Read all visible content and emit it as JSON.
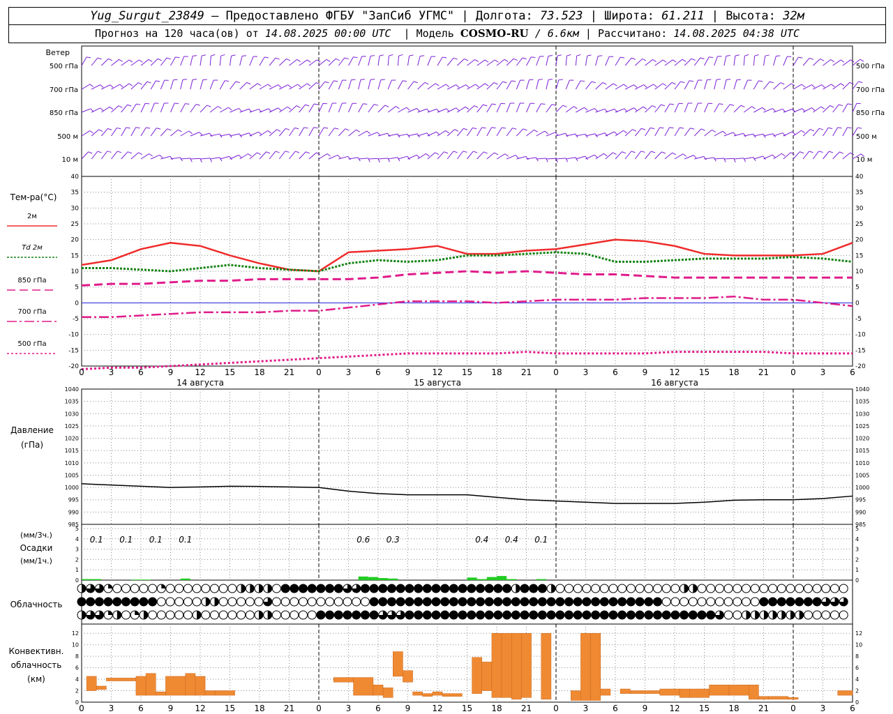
{
  "header": {
    "station": "Yug_Surgut_23849",
    "provider": "— Предоставлено ФГБУ \"ЗапСиб УГМС\"",
    "lon_label": "Долгота:",
    "lon": "73.523",
    "lat_label": "Широта:",
    "lat": "61.211",
    "alt_label": "Высота:",
    "alt": "32м",
    "forecast_label": "Прогноз на 120 часа(ов) от",
    "forecast_from": "14.08.2025 00:00 UTC",
    "model_label": "Модель",
    "model": "COSMO-RU",
    "resolution": "/ 6.6км",
    "computed_label": "Рассчитано:",
    "computed": "14.08.2025 04:38 UTC"
  },
  "labels": {
    "wind": "Ветер",
    "wind_levels": [
      "500 гПа",
      "700 гПа",
      "850 гПа",
      "500 м",
      "10  м"
    ],
    "temp_title": "Тем-ра(°С)",
    "temp_legend": [
      "2м",
      "Td  2м",
      "850 гПа",
      "700 гПа",
      "500 гПа"
    ],
    "pressure_title": "Давление",
    "pressure_unit": "(гПа)",
    "precip_unit_top": "(мм/3ч.)",
    "precip_title": "Осадки",
    "precip_unit_bottom": "(мм/1ч.)",
    "cloud_title": "Облачность",
    "conv_title": "Конвективн.",
    "conv_title2": "облачность",
    "conv_unit": "(км)"
  },
  "colors": {
    "wind": "#7b1fd6",
    "t2m": "#ef2b2b",
    "td2m": "#138213",
    "t850": "#e01b8a",
    "t700": "#e01b8a",
    "t500": "#e01b8a",
    "zero_line": "#2020e0",
    "pressure": "#000000",
    "precip": "#22cc22",
    "conv": "#ef8a33"
  },
  "chart_data": [
    {
      "type": "line",
      "title": "Тем-ра(°С)",
      "x_hours": [
        0,
        3,
        6,
        9,
        12,
        15,
        18,
        21,
        24,
        27,
        30,
        33,
        36,
        39,
        42,
        45,
        48,
        51,
        54,
        57,
        60,
        63,
        66,
        69,
        72,
        75,
        78
      ],
      "x_tick_labels": [
        "0",
        "3",
        "6",
        "9",
        "12",
        "15",
        "18",
        "21",
        "0",
        "3",
        "6",
        "9",
        "12",
        "15",
        "18",
        "21",
        "0",
        "3",
        "6",
        "9",
        "12",
        "15",
        "18",
        "21",
        "0",
        "3",
        "6"
      ],
      "day_labels": [
        "14 августа",
        "15 августа",
        "16 августа"
      ],
      "ylim": [
        -20,
        40
      ],
      "y_ticks": [
        40,
        35,
        30,
        25,
        20,
        15,
        10,
        5,
        0,
        -5,
        -10,
        -15,
        -20
      ],
      "series": [
        {
          "name": "2м",
          "values": [
            12,
            13.5,
            17,
            19,
            18,
            15,
            12.5,
            10.5,
            10,
            16,
            16.5,
            17,
            18,
            15.5,
            15.5,
            16.5,
            17,
            18.5,
            20,
            19.5,
            18,
            15.5,
            15,
            15,
            15,
            15.5,
            19
          ]
        },
        {
          "name": "Td  2м",
          "values": [
            11,
            11,
            10.5,
            10,
            11,
            12,
            11,
            10.5,
            10,
            12.5,
            13.5,
            13,
            13.5,
            15,
            15,
            15.5,
            16,
            15.5,
            13,
            13,
            13.5,
            14,
            14,
            14,
            14.5,
            14,
            13
          ]
        },
        {
          "name": "850 гПа",
          "values": [
            5.5,
            6,
            6,
            6.5,
            7,
            7,
            7.5,
            7.5,
            7.5,
            7.5,
            8,
            9,
            9.5,
            10,
            9.5,
            10,
            9.5,
            9,
            9,
            8.5,
            8,
            8,
            8,
            8,
            8,
            8,
            8
          ]
        },
        {
          "name": "700 гПа",
          "values": [
            -4.5,
            -4.5,
            -4,
            -3.5,
            -3,
            -3,
            -3,
            -2.5,
            -2.5,
            -1.5,
            -0.5,
            0.5,
            0.5,
            0.5,
            0,
            0.5,
            1,
            1,
            1,
            1.5,
            1.5,
            1.5,
            2,
            1,
            1,
            0,
            -1
          ]
        },
        {
          "name": "500 гПа",
          "values": [
            -21,
            -20.5,
            -20.5,
            -20,
            -19.5,
            -19,
            -18.5,
            -18,
            -17.5,
            -17,
            -16.5,
            -16,
            -16,
            -16,
            -16,
            -15.5,
            -16,
            -16,
            -16,
            -16,
            -15.5,
            -15.5,
            -15.5,
            -15.5,
            -16,
            -16,
            -16
          ]
        }
      ]
    },
    {
      "type": "line",
      "title": "Давление",
      "ylabel": "(гПа)",
      "ylim": [
        985,
        1040
      ],
      "y_ticks": [
        1040,
        1035,
        1030,
        1025,
        1020,
        1015,
        1010,
        1005,
        1000,
        995,
        990,
        985
      ],
      "series": [
        {
          "name": "pressure",
          "values": [
            1001.5,
            1001,
            1000.5,
            1000,
            1000.2,
            1000.5,
            1000.4,
            1000.2,
            1000,
            998.5,
            997.5,
            997,
            997,
            997,
            996,
            995,
            994.5,
            994,
            993.5,
            993.5,
            993.5,
            994,
            994.8,
            995,
            995,
            995.5,
            996.5
          ]
        }
      ]
    },
    {
      "type": "bar",
      "title": "Осадки",
      "ylim": [
        0,
        5
      ],
      "y_ticks": [
        5,
        4,
        3,
        2,
        1,
        0
      ],
      "accumulations_3h": [
        {
          "hour": 1.5,
          "label": "0.1"
        },
        {
          "hour": 4.5,
          "label": "0.1"
        },
        {
          "hour": 7.5,
          "label": "0.1"
        },
        {
          "hour": 10.5,
          "label": "0.1"
        },
        {
          "hour": 28.5,
          "label": "0.6"
        },
        {
          "hour": 31.5,
          "label": "0.3"
        },
        {
          "hour": 40.5,
          "label": "0.4"
        },
        {
          "hour": 43.5,
          "label": "0.4"
        },
        {
          "hour": 46.5,
          "label": "0.1"
        }
      ],
      "hourly": [
        {
          "hour": 0,
          "value": 0.1
        },
        {
          "hour": 1,
          "value": 0.1
        },
        {
          "hour": 5,
          "value": 0.05
        },
        {
          "hour": 6,
          "value": 0.05
        },
        {
          "hour": 10,
          "value": 0.15
        },
        {
          "hour": 28,
          "value": 0.35
        },
        {
          "hour": 29,
          "value": 0.3
        },
        {
          "hour": 30,
          "value": 0.2
        },
        {
          "hour": 31,
          "value": 0.15
        },
        {
          "hour": 39,
          "value": 0.25
        },
        {
          "hour": 40,
          "value": 0.1
        },
        {
          "hour": 41,
          "value": 0.3
        },
        {
          "hour": 42,
          "value": 0.4
        },
        {
          "hour": 43,
          "value": 0.1
        },
        {
          "hour": 46,
          "value": 0.1
        }
      ]
    },
    {
      "type": "bar",
      "title": "Конвективн. облачность",
      "ylabel": "(км)",
      "ylim": [
        0,
        13
      ],
      "y_ticks": [
        12,
        10,
        8,
        6,
        4,
        2,
        0
      ],
      "bars": [
        {
          "h0": 0.5,
          "h1": 1.5,
          "base": 2,
          "top": 4.5
        },
        {
          "h0": 1.5,
          "h1": 2.5,
          "base": 2.2,
          "top": 2.8
        },
        {
          "h0": 2.5,
          "h1": 5.5,
          "base": 3.7,
          "top": 4.2
        },
        {
          "h0": 5.5,
          "h1": 6.5,
          "base": 1.2,
          "top": 4.5
        },
        {
          "h0": 6.5,
          "h1": 7.5,
          "base": 1.2,
          "top": 5
        },
        {
          "h0": 7.5,
          "h1": 8.5,
          "base": 1.2,
          "top": 1.8
        },
        {
          "h0": 8.5,
          "h1": 10.5,
          "base": 1.2,
          "top": 4.5
        },
        {
          "h0": 10.5,
          "h1": 11.5,
          "base": 1.2,
          "top": 5
        },
        {
          "h0": 11.5,
          "h1": 12.5,
          "base": 1.2,
          "top": 4.5
        },
        {
          "h0": 12.5,
          "h1": 13.5,
          "base": 1.2,
          "top": 2
        },
        {
          "h0": 13.5,
          "h1": 15.5,
          "base": 1.2,
          "top": 2
        },
        {
          "h0": 25.5,
          "h1": 27.5,
          "base": 3.5,
          "top": 4.3
        },
        {
          "h0": 27.5,
          "h1": 29.5,
          "base": 1.2,
          "top": 4.3
        },
        {
          "h0": 29.5,
          "h1": 30.5,
          "base": 1.2,
          "top": 3
        },
        {
          "h0": 30.5,
          "h1": 31.5,
          "base": 0.8,
          "top": 2.5
        },
        {
          "h0": 31.5,
          "h1": 32.5,
          "base": 4.5,
          "top": 8.8
        },
        {
          "h0": 32.5,
          "h1": 33.5,
          "base": 3.5,
          "top": 5.5
        },
        {
          "h0": 33.5,
          "h1": 34.5,
          "base": 1.2,
          "top": 1.8
        },
        {
          "h0": 34.5,
          "h1": 35.5,
          "base": 1,
          "top": 1.5
        },
        {
          "h0": 35.5,
          "h1": 36.5,
          "base": 1.2,
          "top": 1.8
        },
        {
          "h0": 36.5,
          "h1": 38.5,
          "base": 1,
          "top": 1.5
        },
        {
          "h0": 39.5,
          "h1": 40.5,
          "base": 1.5,
          "top": 7.8
        },
        {
          "h0": 40.5,
          "h1": 41.5,
          "base": 2,
          "top": 7
        },
        {
          "h0": 41.5,
          "h1": 42.5,
          "base": 0.8,
          "top": 12
        },
        {
          "h0": 42.5,
          "h1": 43.5,
          "base": 0.8,
          "top": 12
        },
        {
          "h0": 43.5,
          "h1": 44.5,
          "base": 0.5,
          "top": 12
        },
        {
          "h0": 44.5,
          "h1": 45.5,
          "base": 0.8,
          "top": 12
        },
        {
          "h0": 46.5,
          "h1": 47.5,
          "base": 0.5,
          "top": 12
        },
        {
          "h0": 49.5,
          "h1": 50.5,
          "base": 0.3,
          "top": 2
        },
        {
          "h0": 50.5,
          "h1": 51.5,
          "base": 0.3,
          "top": 12
        },
        {
          "h0": 51.5,
          "h1": 52.5,
          "base": 0.3,
          "top": 12
        },
        {
          "h0": 52.5,
          "h1": 53.5,
          "base": 1.2,
          "top": 2.3
        },
        {
          "h0": 54.5,
          "h1": 55.5,
          "base": 1.5,
          "top": 2.3
        },
        {
          "h0": 55.5,
          "h1": 58.5,
          "base": 1.5,
          "top": 2
        },
        {
          "h0": 58.5,
          "h1": 60.5,
          "base": 1.2,
          "top": 2.3
        },
        {
          "h0": 60.5,
          "h1": 61.5,
          "base": 0.8,
          "top": 2.3
        },
        {
          "h0": 61.5,
          "h1": 63.5,
          "base": 0.8,
          "top": 2.3
        },
        {
          "h0": 63.5,
          "h1": 65.5,
          "base": 1.2,
          "top": 3
        },
        {
          "h0": 65.5,
          "h1": 67.5,
          "base": 1.2,
          "top": 3
        },
        {
          "h0": 67.5,
          "h1": 68.5,
          "base": 0.5,
          "top": 3
        },
        {
          "h0": 68.5,
          "h1": 69.5,
          "base": 0.5,
          "top": 1
        },
        {
          "h0": 69.5,
          "h1": 71.5,
          "base": 0.5,
          "top": 1
        },
        {
          "h0": 71.5,
          "h1": 72.5,
          "base": 0.5,
          "top": 0.8
        },
        {
          "h0": 76.5,
          "h1": 78,
          "base": 1.2,
          "top": 2
        }
      ]
    }
  ],
  "cloud_rows": {
    "row1": "234444444444444444444444444444444444444444444441222222222222222222222222222222222222222222222222222222222222222222222222222222",
    "row2": "4",
    "row3": "4"
  }
}
